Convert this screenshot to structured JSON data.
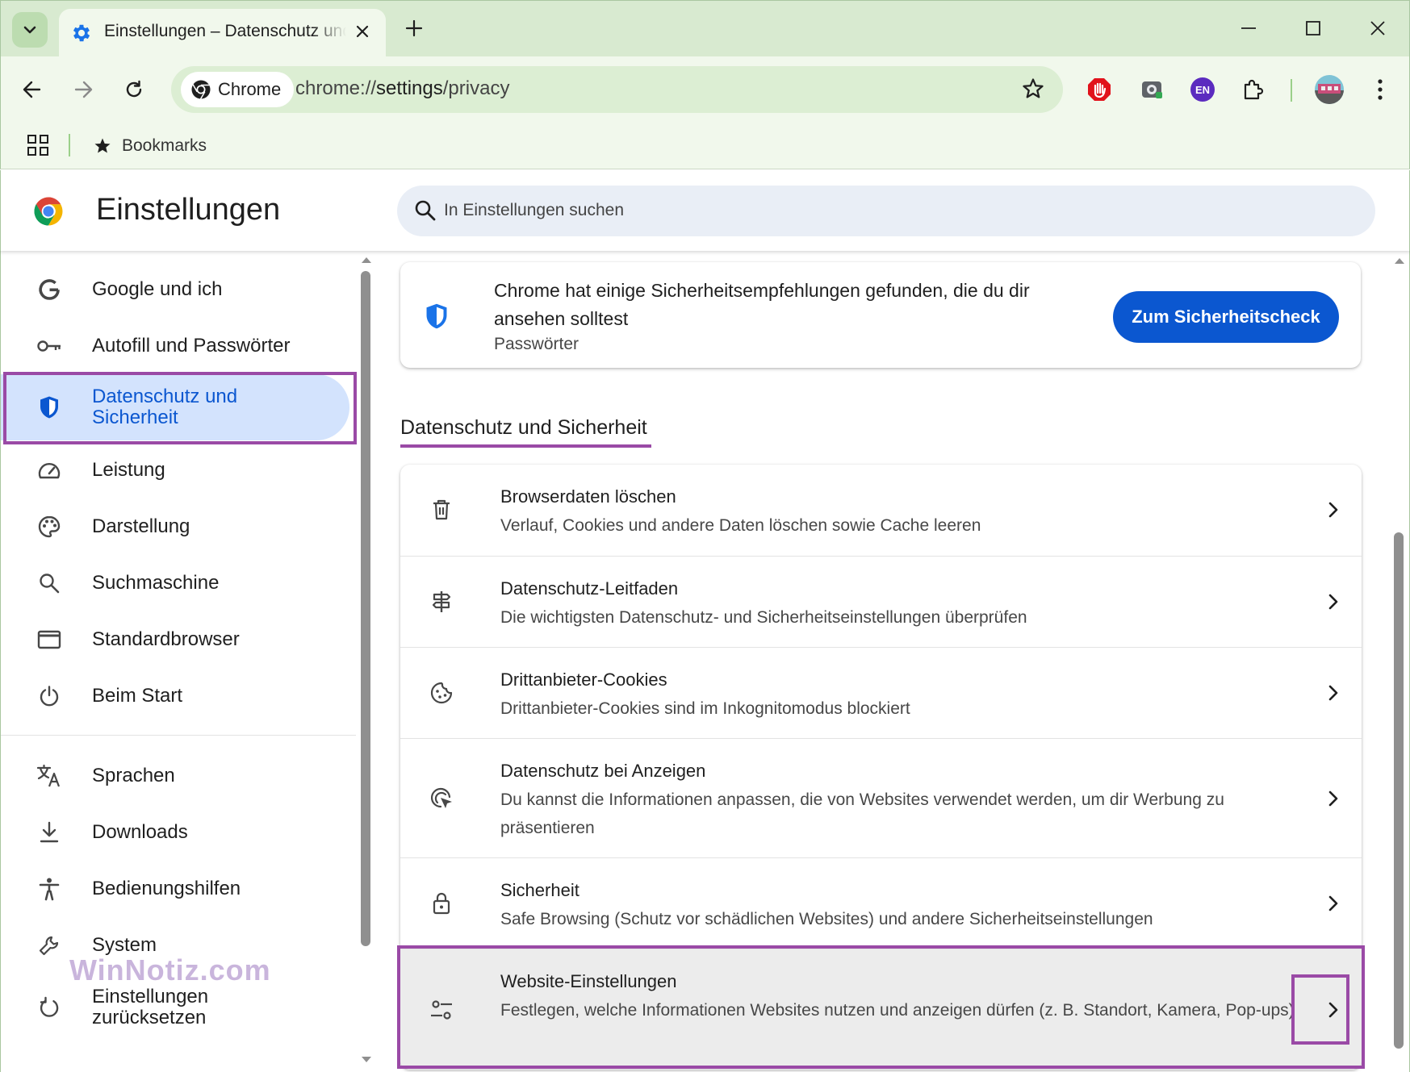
{
  "browser": {
    "tab": {
      "title": "Einstellungen – Datenschutz und Sicherheit"
    },
    "omnibox": {
      "chip_label": "Chrome",
      "url_prefix": "chrome://",
      "url_host": "settings",
      "url_path": "/privacy"
    },
    "extensions": {
      "language_badge": "EN"
    },
    "bookmarks_bar": {
      "item": "Bookmarks"
    }
  },
  "header": {
    "title": "Einstellungen",
    "search_placeholder": "In Einstellungen suchen"
  },
  "sidebar": {
    "items": [
      {
        "label": "Google und ich",
        "icon": "google-g-icon"
      },
      {
        "label": "Autofill und Passwörter",
        "icon": "key-icon"
      },
      {
        "label": "Datenschutz und Sicherheit",
        "icon": "shield-icon",
        "active": true
      },
      {
        "label": "Leistung",
        "icon": "speedometer-icon"
      },
      {
        "label": "Darstellung",
        "icon": "palette-icon"
      },
      {
        "label": "Suchmaschine",
        "icon": "search-icon"
      },
      {
        "label": "Standardbrowser",
        "icon": "browser-window-icon"
      },
      {
        "label": "Beim Start",
        "icon": "power-icon"
      },
      {
        "label": "Sprachen",
        "icon": "translate-icon"
      },
      {
        "label": "Downloads",
        "icon": "download-icon"
      },
      {
        "label": "Bedienungshilfen",
        "icon": "accessibility-icon"
      },
      {
        "label": "System",
        "icon": "wrench-icon"
      },
      {
        "label": "Einstellungen zurücksetzen",
        "icon": "reset-icon"
      }
    ]
  },
  "watermark": "WinNotiz.com",
  "promo": {
    "title": "Chrome hat einige Sicherheitsempfehlungen gefunden, die du dir ansehen solltest",
    "subtitle": "Passwörter",
    "button": "Zum Sicherheitscheck"
  },
  "section": {
    "title": "Datenschutz und Sicherheit",
    "rows": [
      {
        "title": "Browserdaten löschen",
        "subtitle": "Verlauf, Cookies und andere Daten löschen sowie Cache leeren",
        "icon": "trash-icon"
      },
      {
        "title": "Datenschutz-Leitfaden",
        "subtitle": "Die wichtigsten Datenschutz- und Sicherheitseinstellungen überprüfen",
        "icon": "signpost-icon"
      },
      {
        "title": "Drittanbieter-Cookies",
        "subtitle": "Drittanbieter-Cookies sind im Inkognitomodus blockiert",
        "icon": "cookie-icon"
      },
      {
        "title": "Datenschutz bei Anzeigen",
        "subtitle": "Du kannst die Informationen anpassen, die von Websites verwendet werden, um dir Werbung zu präsentieren",
        "icon": "ad-privacy-icon"
      },
      {
        "title": "Sicherheit",
        "subtitle": "Safe Browsing (Schutz vor schädlichen Websites) und andere Sicherheitseinstellungen",
        "icon": "lock-icon"
      },
      {
        "title": "Website-Einstellungen",
        "subtitle": "Festlegen, welche Informationen Websites nutzen und anzeigen dürfen (z. B. Standort, Kamera, Pop-ups)",
        "icon": "tune-icon"
      }
    ]
  },
  "colors": {
    "accent": "#0b57d0",
    "active_nav_bg": "#d3e3fd",
    "highlight": "#9a4aa6",
    "frame": "#d8ead0"
  }
}
